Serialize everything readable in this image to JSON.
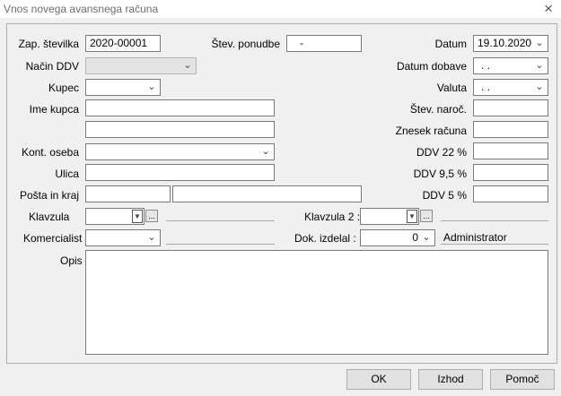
{
  "window": {
    "title": "Vnos novega avansnega računa",
    "close_icon": "×"
  },
  "fields": {
    "zap_stevilka": {
      "label": "Zap. številka",
      "value": "2020-00001"
    },
    "stev_ponudbe": {
      "label": "Štev. ponudbe",
      "value": "-"
    },
    "datum": {
      "label": "Datum",
      "value": "19.10.2020"
    },
    "nacin_ddv": {
      "label": "Način DDV",
      "value": ""
    },
    "datum_dobave": {
      "label": "Datum dobave",
      "value": ". ."
    },
    "kupec": {
      "label": "Kupec",
      "value": ""
    },
    "valuta": {
      "label": "Valuta",
      "value": ". ."
    },
    "ime_kupca": {
      "label": "Ime kupca",
      "value": "",
      "value2": ""
    },
    "stev_naroc": {
      "label": "Štev. naroč.",
      "value": ""
    },
    "znesek_racuna": {
      "label": "Znesek računa",
      "value": ""
    },
    "kont_oseba": {
      "label": "Kont. oseba",
      "value": ""
    },
    "ddv22": {
      "label": "DDV 22 %",
      "value": ""
    },
    "ulica": {
      "label": "Ulica",
      "value": ""
    },
    "ddv95": {
      "label": "DDV 9,5 %",
      "value": ""
    },
    "posta_in_kraj": {
      "label": "Pošta in kraj",
      "value": "",
      "value2": ""
    },
    "ddv5": {
      "label": "DDV 5 %",
      "value": ""
    },
    "klavzula": {
      "label": "Klavzula",
      "value": "",
      "ellipsis": "...",
      "text": ""
    },
    "klavzula2": {
      "label": "Klavzula 2 :",
      "value": "",
      "ellipsis": "...",
      "text": ""
    },
    "komercialist": {
      "label": "Komercialist",
      "value": "",
      "text": ""
    },
    "dok_izdelal": {
      "label": "Dok. izdelal :",
      "value": "0",
      "name": "Administrator"
    },
    "opis": {
      "label": "Opis",
      "value": ""
    }
  },
  "buttons": {
    "ok": "OK",
    "izhod": "Izhod",
    "pomoc": "Pomoč"
  },
  "icons": {
    "dropdown": "chevron-down-icon",
    "dropdown_glyph": "⌄"
  }
}
